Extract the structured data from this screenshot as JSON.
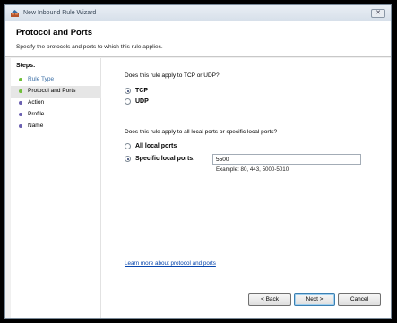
{
  "window": {
    "title": "New Inbound Rule Wizard",
    "close_label": "✕"
  },
  "header": {
    "title": "Protocol and Ports",
    "subtitle": "Specify the protocols and ports to which this rule applies."
  },
  "sidebar": {
    "steps_label": "Steps:",
    "items": [
      {
        "label": "Rule Type",
        "state": "done",
        "dot_color": "#6fbf3a"
      },
      {
        "label": "Protocol and Ports",
        "state": "current",
        "dot_color": "#6fbf3a"
      },
      {
        "label": "Action",
        "state": "pending",
        "dot_color": "#6a5fb0"
      },
      {
        "label": "Profile",
        "state": "pending",
        "dot_color": "#6a5fb0"
      },
      {
        "label": "Name",
        "state": "pending",
        "dot_color": "#6a5fb0"
      }
    ]
  },
  "protocol": {
    "question": "Does this rule apply to TCP or UDP?",
    "options": [
      {
        "label": "TCP",
        "checked": true
      },
      {
        "label": "UDP",
        "checked": false
      }
    ]
  },
  "ports": {
    "question": "Does this rule apply to all local ports or specific local ports?",
    "options": [
      {
        "label": "All local ports",
        "checked": false
      },
      {
        "label": "Specific local ports:",
        "checked": true
      }
    ],
    "value": "5500",
    "example": "Example: 80, 443, 5000-5010"
  },
  "learn_more": "Learn more about protocol and ports",
  "buttons": {
    "back": "< Back",
    "next": "Next >",
    "cancel": "Cancel"
  }
}
